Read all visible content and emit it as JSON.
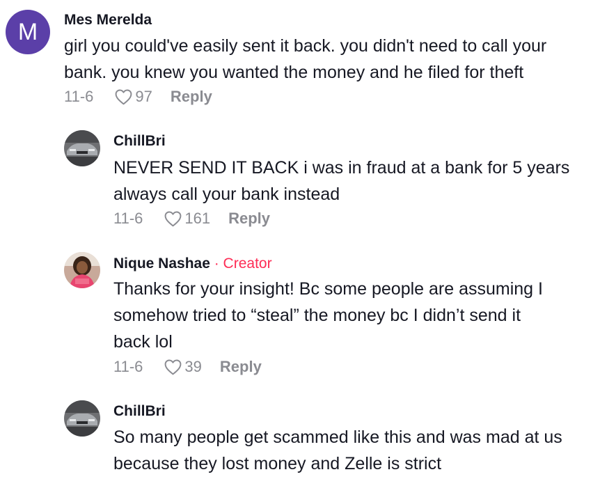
{
  "comments": [
    {
      "avatar_letter": "M",
      "avatar_color": "#5b3fa8",
      "username": "Mes Merelda",
      "text": "girl you could've easily sent it back. you didn't need to call your\nbank. you knew you wanted the money and he filed for theft",
      "date": "11-6",
      "likes": "97",
      "reply_label": "Reply"
    },
    {
      "avatar_icon": "car-avatar",
      "username": "ChillBri",
      "text": "NEVER SEND IT BACK i was in fraud at a bank for 5 years\nalways call your bank instead",
      "date": "11-6",
      "likes": "161",
      "reply_label": "Reply"
    },
    {
      "avatar_icon": "person-avatar",
      "username": "Nique Nashae",
      "creator_tag": " · Creator",
      "text": "Thanks for your insight! Bc some people are assuming I\nsomehow tried to “steal” the money bc I didn’t send it\nback lol",
      "date": "11-6",
      "likes": "39",
      "reply_label": "Reply"
    },
    {
      "avatar_icon": "car-avatar",
      "username": "ChillBri",
      "text": "So many people get scammed like this and was mad at us\nbecause they lost money and Zelle is strict"
    }
  ],
  "colors": {
    "creator_accent": "#fe2c55",
    "meta_gray": "#8a8b91",
    "text_dark": "#161823"
  }
}
